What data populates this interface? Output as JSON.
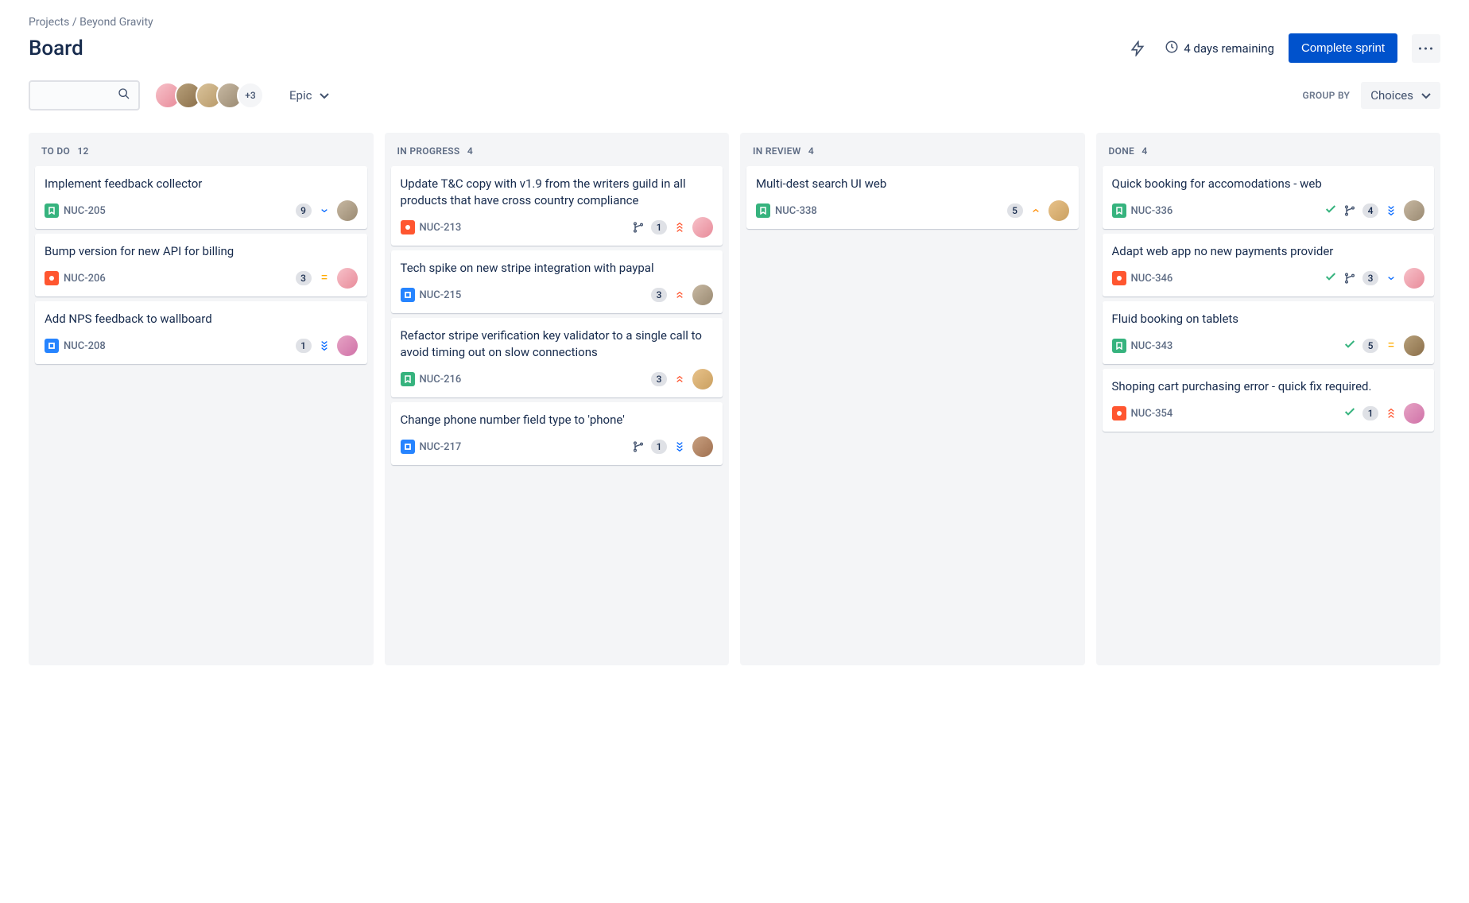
{
  "breadcrumb": {
    "projects": "Projects",
    "sep": "/",
    "project": "Beyond Gravity"
  },
  "page_title": "Board",
  "header": {
    "days_remaining": "4 days remaining",
    "complete_sprint": "Complete sprint"
  },
  "toolbar": {
    "avatar_more": "+3",
    "epic_label": "Epic",
    "group_by_label": "GROUP BY",
    "choices_label": "Choices"
  },
  "columns": [
    {
      "title": "TO DO",
      "count": "12"
    },
    {
      "title": "IN PROGRESS",
      "count": "4"
    },
    {
      "title": "IN REVIEW",
      "count": "4"
    },
    {
      "title": "DONE",
      "count": "4"
    }
  ],
  "cards": {
    "todo": [
      {
        "title": "Implement feedback collector",
        "key": "NUC-205",
        "type": "story",
        "estimate": "9",
        "priority": "low",
        "assignee": "av4"
      },
      {
        "title": "Bump version for new API for billing",
        "key": "NUC-206",
        "type": "bug",
        "estimate": "3",
        "priority": "medium",
        "assignee": "av1"
      },
      {
        "title": "Add NPS feedback to wallboard",
        "key": "NUC-208",
        "type": "task",
        "estimate": "1",
        "priority": "lowest",
        "assignee": "av5"
      }
    ],
    "inprogress": [
      {
        "title": "Update T&C copy with v1.9 from the writers guild in all products that have cross country compliance",
        "key": "NUC-213",
        "type": "bug",
        "branch": true,
        "estimate": "1",
        "priority": "highest",
        "assignee": "av1"
      },
      {
        "title": "Tech spike on new stripe integration with paypal",
        "key": "NUC-215",
        "type": "task",
        "estimate": "3",
        "priority": "high",
        "assignee": "av4"
      },
      {
        "title": "Refactor stripe verification key validator to a single call to avoid timing out on slow connections",
        "key": "NUC-216",
        "type": "story",
        "estimate": "3",
        "priority": "high",
        "assignee": "av6"
      },
      {
        "title": "Change phone number field type to 'phone'",
        "key": "NUC-217",
        "type": "task",
        "branch": true,
        "estimate": "1",
        "priority": "lowest",
        "assignee": "av7"
      }
    ],
    "inreview": [
      {
        "title": "Multi-dest search UI web",
        "key": "NUC-338",
        "type": "story",
        "estimate": "5",
        "priority": "medium-high",
        "assignee": "av6"
      }
    ],
    "done": [
      {
        "title": "Quick booking for accomodations - web",
        "key": "NUC-336",
        "type": "story",
        "check": true,
        "branch": true,
        "estimate": "4",
        "priority": "lowest",
        "assignee": "av4"
      },
      {
        "title": "Adapt web app no new payments provider",
        "key": "NUC-346",
        "type": "bug",
        "check": true,
        "branch": true,
        "estimate": "3",
        "priority": "low",
        "assignee": "av1"
      },
      {
        "title": "Fluid booking on tablets",
        "key": "NUC-343",
        "type": "story",
        "check": true,
        "estimate": "5",
        "priority": "medium",
        "assignee": "av2"
      },
      {
        "title": "Shoping cart purchasing error - quick fix required.",
        "key": "NUC-354",
        "type": "bug",
        "check": true,
        "estimate": "1",
        "priority": "highest",
        "assignee": "av5"
      }
    ]
  }
}
